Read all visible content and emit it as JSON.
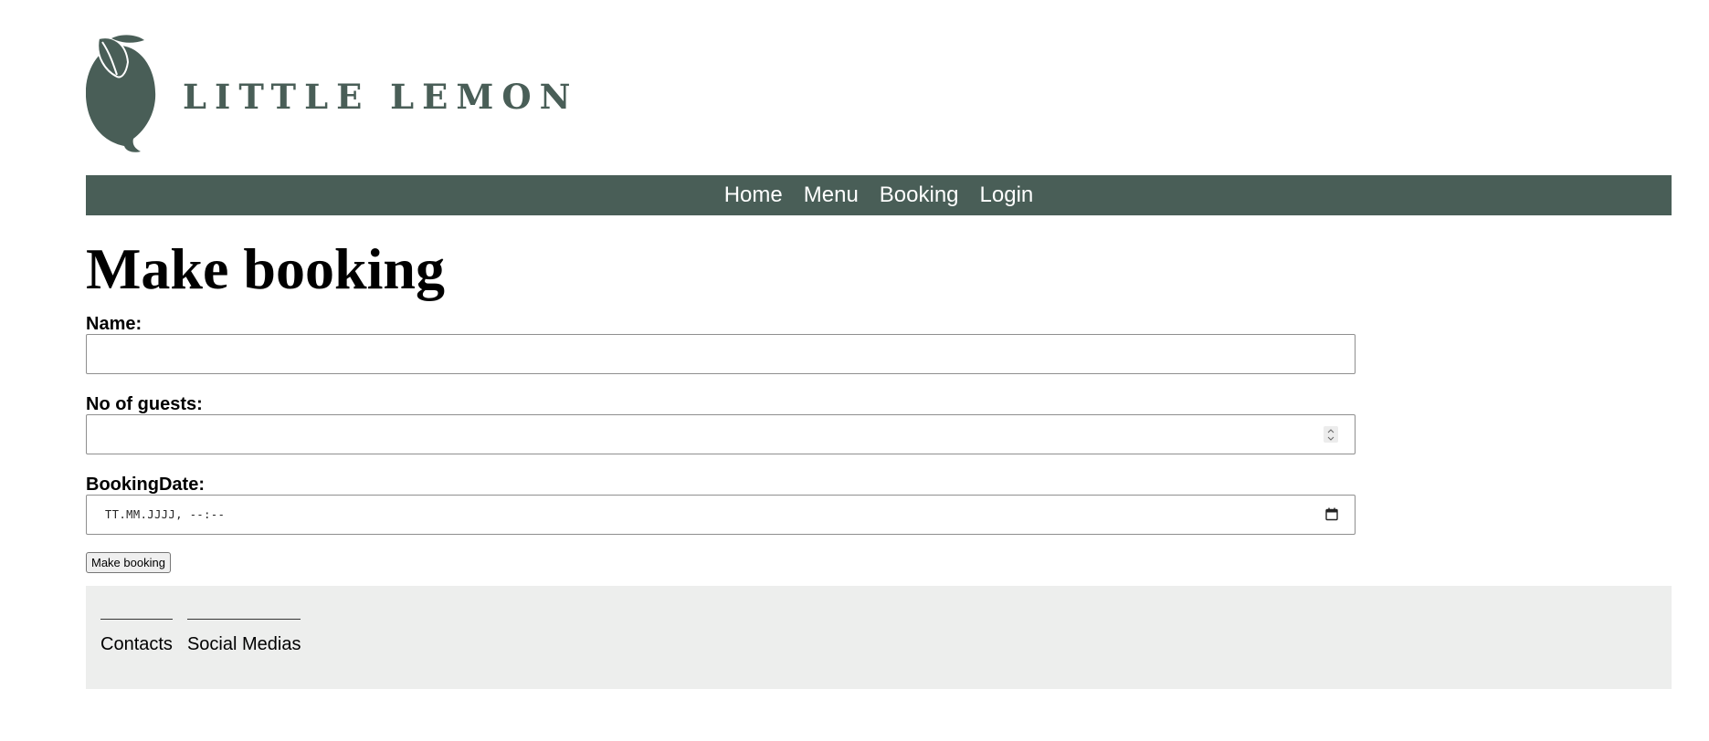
{
  "brand": {
    "name": "LITTLE LEMON",
    "logo_icon": "lemon-icon",
    "color": "#495e57"
  },
  "nav": {
    "items": [
      "Home",
      "Menu",
      "Booking",
      "Login"
    ]
  },
  "page": {
    "title": "Make booking"
  },
  "form": {
    "name": {
      "label": "Name:",
      "value": ""
    },
    "guests": {
      "label": "No of guests:",
      "value": ""
    },
    "date": {
      "label": "BookingDate:",
      "placeholder": "TT.MM.JJJJ, --:--",
      "icon": "calendar-icon"
    },
    "submit_label": "Make booking"
  },
  "footer": {
    "columns": [
      "Contacts",
      "Social Medias"
    ],
    "background": "#edeeed"
  }
}
